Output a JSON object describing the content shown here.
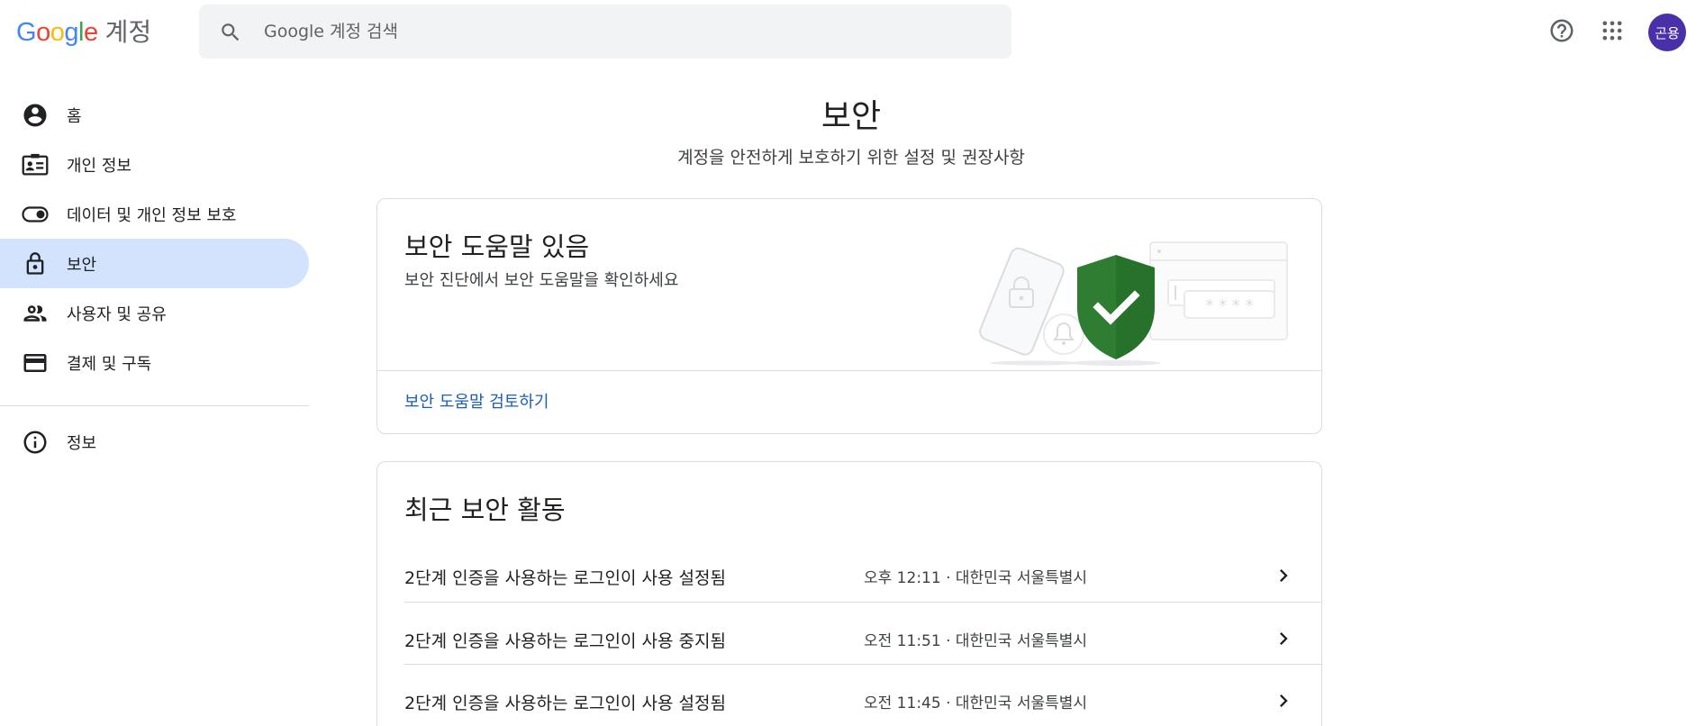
{
  "header": {
    "logo_letters": [
      "G",
      "o",
      "o",
      "g",
      "l",
      "e"
    ],
    "product": "계정",
    "search_placeholder": "Google 계정 검색",
    "avatar_text": "곤용"
  },
  "icons": {
    "search": "search-icon",
    "help": "help-icon",
    "apps": "apps-grid-icon",
    "chevron": "chevron-right-icon"
  },
  "sidebar": {
    "items": [
      {
        "label": "홈",
        "icon": "account-circle-icon",
        "active": false
      },
      {
        "label": "개인 정보",
        "icon": "id-card-icon",
        "active": false
      },
      {
        "label": "데이터 및 개인 정보 보호",
        "icon": "toggle-icon",
        "active": false
      },
      {
        "label": "보안",
        "icon": "lock-icon",
        "active": true
      },
      {
        "label": "사용자 및 공유",
        "icon": "people-icon",
        "active": false
      },
      {
        "label": "결제 및 구독",
        "icon": "credit-card-icon",
        "active": false
      }
    ],
    "footer_item": {
      "label": "정보",
      "icon": "info-icon"
    }
  },
  "main": {
    "title": "보안",
    "subtitle": "계정을 안전하게 보호하기 위한 설정 및 권장사항",
    "tips_card": {
      "title": "보안 도움말 있음",
      "description": "보안 진단에서 보안 도움말을 확인하세요",
      "link": "보안 도움말 검토하기",
      "password_mask": "* * * *"
    },
    "activity_card": {
      "title": "최근 보안 활동",
      "rows": [
        {
          "label": "2단계 인증을 사용하는 로그인이 사용 설정됨",
          "meta": "오후 12:11 · 대한민국 서울특별시"
        },
        {
          "label": "2단계 인증을 사용하는 로그인이 사용 중지됨",
          "meta": "오전 11:51 · 대한민국 서울특별시"
        },
        {
          "label": "2단계 인증을 사용하는 로그인이 사용 설정됨",
          "meta": "오전 11:45 · 대한민국 서울특별시"
        }
      ]
    }
  },
  "colors": {
    "active_nav_bg": "#d3e3fd",
    "link": "#1a5fb4",
    "shield": "#2e7d32",
    "avatar_bg": "#4a30a8"
  }
}
